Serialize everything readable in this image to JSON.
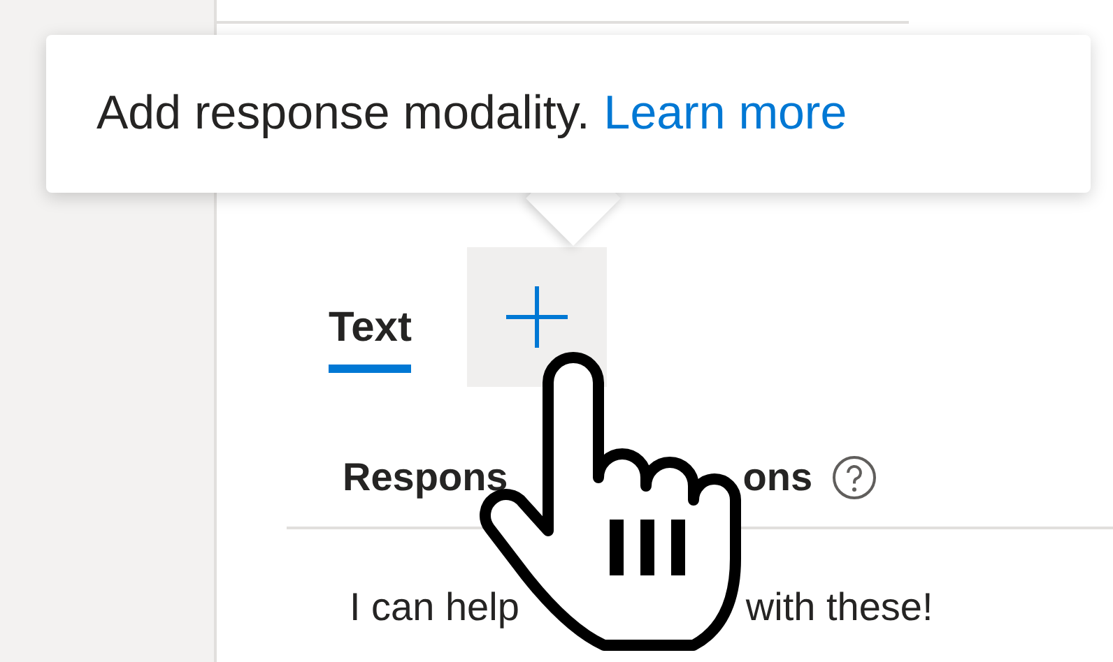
{
  "tooltip": {
    "text": "Add response modality.",
    "link": "Learn more"
  },
  "tabs": [
    {
      "label": "Text",
      "selected": true
    }
  ],
  "section": {
    "title_parts": [
      "Respons",
      "ons"
    ]
  },
  "responses": [
    {
      "parts": [
        "I can help",
        "with these!"
      ]
    }
  ]
}
